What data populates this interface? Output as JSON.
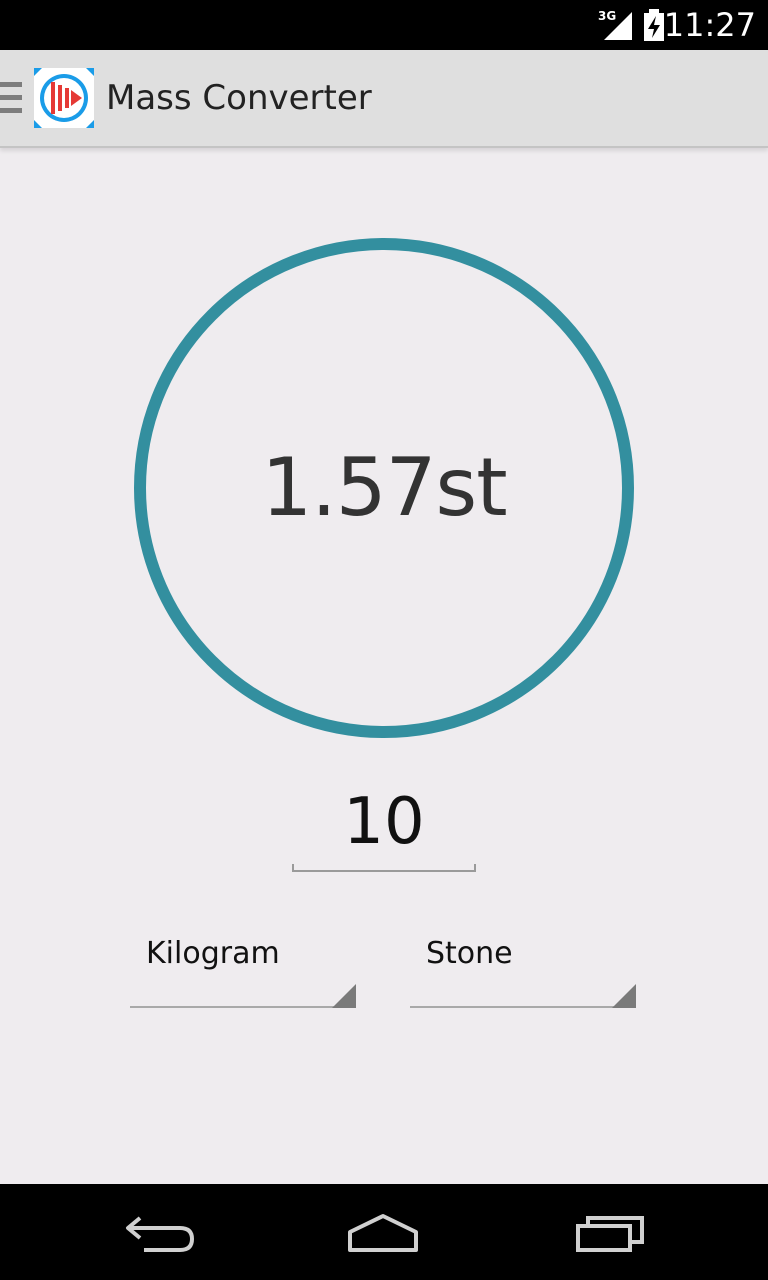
{
  "status_bar": {
    "time": "11:27",
    "network": "3G",
    "icons": [
      "signal-3g-icon",
      "battery-charging-icon"
    ]
  },
  "action_bar": {
    "title": "Mass Converter",
    "icons": [
      "drawer-menu-icon",
      "app-logo-icon"
    ]
  },
  "converter": {
    "result": "1.57st",
    "amount": "10",
    "from_unit": "Kilogram",
    "to_unit": "Stone"
  },
  "nav_bar": {
    "icons": [
      "back-icon",
      "home-icon",
      "recents-icon"
    ]
  },
  "colors": {
    "ring": "#338f9f",
    "background": "#efecef",
    "action_bar": "#dfdfdf",
    "logo_blue": "#1a9ce8",
    "logo_red": "#e53935"
  }
}
